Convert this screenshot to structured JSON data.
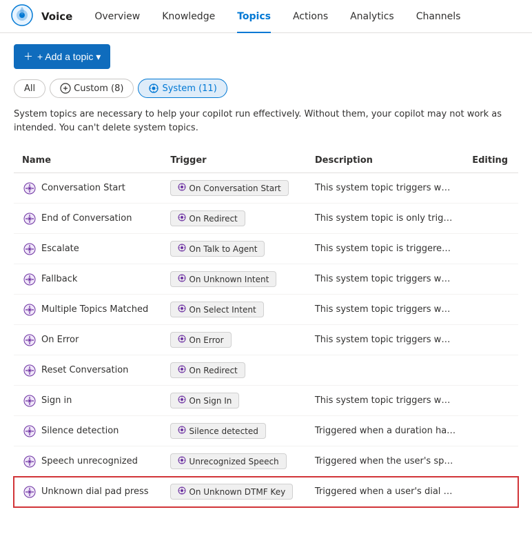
{
  "app": {
    "logo_alt": "Copilot Studio Logo",
    "title": "Voice"
  },
  "nav": {
    "links": [
      {
        "id": "overview",
        "label": "Overview",
        "active": false
      },
      {
        "id": "knowledge",
        "label": "Knowledge",
        "active": false
      },
      {
        "id": "topics",
        "label": "Topics",
        "active": true
      },
      {
        "id": "actions",
        "label": "Actions",
        "active": false
      },
      {
        "id": "analytics",
        "label": "Analytics",
        "active": false
      },
      {
        "id": "channels",
        "label": "Channels",
        "active": false
      }
    ]
  },
  "toolbar": {
    "add_topic_label": "+ Add a topic ▾"
  },
  "filters": {
    "all_label": "All",
    "custom_label": "Custom (8)",
    "system_label": "System (11)"
  },
  "info_text": "System topics are necessary to help your copilot run effectively. Without them, your copilot may not work as intended. You can't delete system topics.",
  "table": {
    "headers": {
      "name": "Name",
      "trigger": "Trigger",
      "description": "Description",
      "editing": "Editing"
    },
    "rows": [
      {
        "id": "conversation-start",
        "name": "Conversation Start",
        "trigger": "On Conversation Start",
        "description": "This system topic triggers when the b...",
        "highlighted": false
      },
      {
        "id": "end-of-conversation",
        "name": "End of Conversation",
        "trigger": "On Redirect",
        "description": "This system topic is only triggered by ...",
        "highlighted": false
      },
      {
        "id": "escalate",
        "name": "Escalate",
        "trigger": "On Talk to Agent",
        "description": "This system topic is triggered when t...",
        "highlighted": false
      },
      {
        "id": "fallback",
        "name": "Fallback",
        "trigger": "On Unknown Intent",
        "description": "This system topic triggers when the u...",
        "highlighted": false
      },
      {
        "id": "multiple-topics-matched",
        "name": "Multiple Topics Matched",
        "trigger": "On Select Intent",
        "description": "This system topic triggers when the b...",
        "highlighted": false
      },
      {
        "id": "on-error",
        "name": "On Error",
        "trigger": "On Error",
        "description": "This system topic triggers when the b...",
        "highlighted": false
      },
      {
        "id": "reset-conversation",
        "name": "Reset Conversation",
        "trigger": "On Redirect",
        "description": "",
        "highlighted": false
      },
      {
        "id": "sign-in",
        "name": "Sign in",
        "trigger": "On Sign In",
        "description": "This system topic triggers when the b...",
        "highlighted": false
      },
      {
        "id": "silence-detection",
        "name": "Silence detection",
        "trigger": "Silence detected",
        "description": "Triggered when a duration has passe...",
        "highlighted": false
      },
      {
        "id": "speech-unrecognized",
        "name": "Speech unrecognized",
        "trigger": "Unrecognized Speech",
        "description": "Triggered when the user's speech inp...",
        "highlighted": false
      },
      {
        "id": "unknown-dial-pad-press",
        "name": "Unknown dial pad press",
        "trigger": "On Unknown DTMF Key",
        "description": "Triggered when a user's dial pad inpu...",
        "highlighted": true
      }
    ]
  },
  "colors": {
    "brand_blue": "#0f6cbd",
    "highlight_red": "#d13438",
    "purple": "#6b2fa0",
    "active_blue": "#0078d4"
  }
}
